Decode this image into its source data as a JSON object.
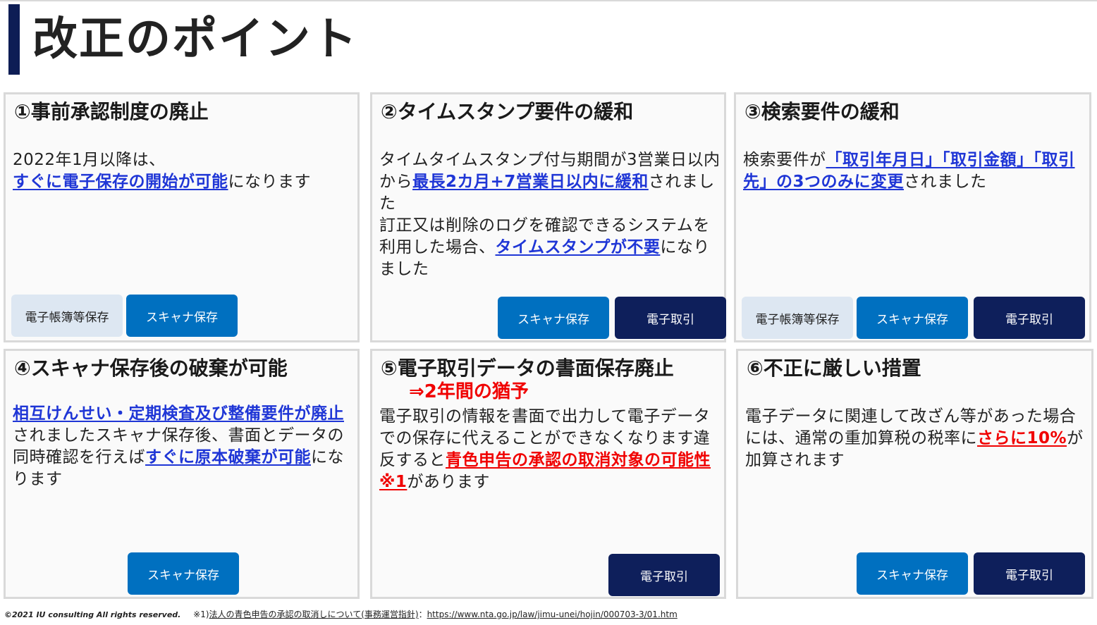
{
  "page": {
    "title": "改正のポイント"
  },
  "cards": [
    {
      "heading": "①事前承認制度の廃止",
      "body": [
        {
          "t": "2022年1月以降は、"
        },
        {
          "br": true
        },
        {
          "t": "すぐに電子保存の開始が可能",
          "hl": "blue"
        },
        {
          "t": "になります"
        }
      ],
      "tags": [
        "電子帳簿等保存",
        "スキャナ保存"
      ]
    },
    {
      "heading": "②タイムスタンプ要件の緩和",
      "body": [
        {
          "t": "タイムタイムスタンプ付与期間が3営業日以内から"
        },
        {
          "t": "最長2カ月+7営業日以内に緩和",
          "hl": "blue"
        },
        {
          "t": "されました"
        },
        {
          "br": true
        },
        {
          "t": "訂正又は削除のログを確認できるシステムを利用した場合、"
        },
        {
          "t": "タイムスタンプが不要",
          "hl": "blue"
        },
        {
          "t": "になりました"
        }
      ],
      "tags": [
        "スキャナ保存",
        "電子取引"
      ]
    },
    {
      "heading": "③検索要件の緩和",
      "body": [
        {
          "t": "検索要件が"
        },
        {
          "t": "「取引年月日」「取引金額」「取引先」の3つのみに変更",
          "hl": "blue"
        },
        {
          "t": "されました"
        }
      ],
      "tags": [
        "電子帳簿等保存",
        "スキャナ保存",
        "電子取引"
      ]
    },
    {
      "heading": "④スキャナ保存後の破棄が可能",
      "body": [
        {
          "t": "相互けんせい・定期検査及び整備要件が廃止",
          "hl": "blue"
        },
        {
          "t": "されましたスキャナ保存後、書面とデータの同時確認を行えば"
        },
        {
          "t": "すぐに原本破棄が可能",
          "hl": "blue"
        },
        {
          "t": "になります"
        }
      ],
      "tags": [
        "スキャナ保存"
      ]
    },
    {
      "heading": "⑤電子取引データの書面保存廃止",
      "subheading": "⇒2年間の猶予",
      "body": [
        {
          "t": "電子取引の情報を書面で出力して電子データでの保存に代えることができなくなります違反すると"
        },
        {
          "t": "青色申告の承認の取消対象の可能性※1",
          "hl": "red"
        },
        {
          "t": "があります"
        }
      ],
      "tags": [
        "電子取引"
      ]
    },
    {
      "heading": "⑥不正に厳しい措置",
      "body": [
        {
          "t": "電子データに関連して改ざん等があった場合には、通常の重加算税の税率に"
        },
        {
          "t": "さらに10%",
          "hl": "red"
        },
        {
          "t": "が加算されます"
        }
      ],
      "tags": [
        "スキャナ保存",
        "電子取引"
      ]
    }
  ],
  "footer": {
    "copyright": "©2021 IU consulting  All rights reserved.",
    "note_prefix": "※1)",
    "note_title": "法人の青色申告の承認の取消しについて(事務運営指針)",
    "note_sep": "：",
    "note_url": "https://www.nta.go.jp/law/jimu-unei/hojin/000703-3/01.htm"
  },
  "colors": {
    "title_bar": "#0d1d55",
    "highlight_blue": "#1f36d6",
    "highlight_red": "#f00000",
    "tag_light": "#dde7f2",
    "tag_mid": "#0070c0",
    "tag_dark": "#0e1f5b",
    "card_border": "#d9d9d9"
  }
}
